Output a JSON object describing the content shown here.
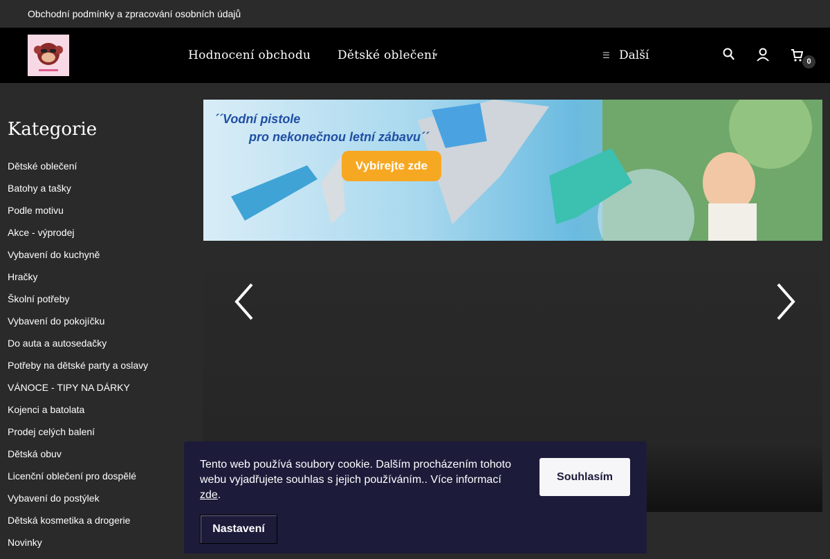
{
  "topbar": {
    "link": "Obchodní podmínky a zpracování osobních údajů"
  },
  "header": {
    "nav": [
      {
        "label": "Hodnocení obchodu"
      },
      {
        "label": "Dětské oblečení"
      }
    ],
    "more_label": "Další",
    "cart_count": "0"
  },
  "sidebar": {
    "title": "Kategorie",
    "items": [
      "Dětské oblečení",
      "Batohy a tašky",
      "Podle motivu",
      "Akce - výprodej",
      "Vybavení do kuchyně",
      "Hračky",
      "Školní potřeby",
      "Vybavení do pokojíčku",
      "Do auta a autosedačky",
      "Potřeby na dětské party a oslavy",
      "VÁNOCE - TIPY NA DÁRKY",
      "Kojenci a batolata",
      "Prodej celých balení",
      "Dětská obuv",
      "Licenční oblečení pro dospělé",
      "Vybavení do postýlek",
      "Dětská kosmetika a drogerie",
      "Novinky"
    ]
  },
  "banner": {
    "line1": "´´Vodní pistole",
    "line2": "pro nekonečnou letní zábavu´´",
    "button": "Vybírejte zde"
  },
  "cookie": {
    "text": "Tento web používá soubory cookie. Dalším procházením tohoto webu vyjadřujete souhlas s jejich používáním.. Více informací ",
    "link": "zde",
    "after_link": ".",
    "agree": "Souhlasím",
    "settings": "Nastavení"
  }
}
